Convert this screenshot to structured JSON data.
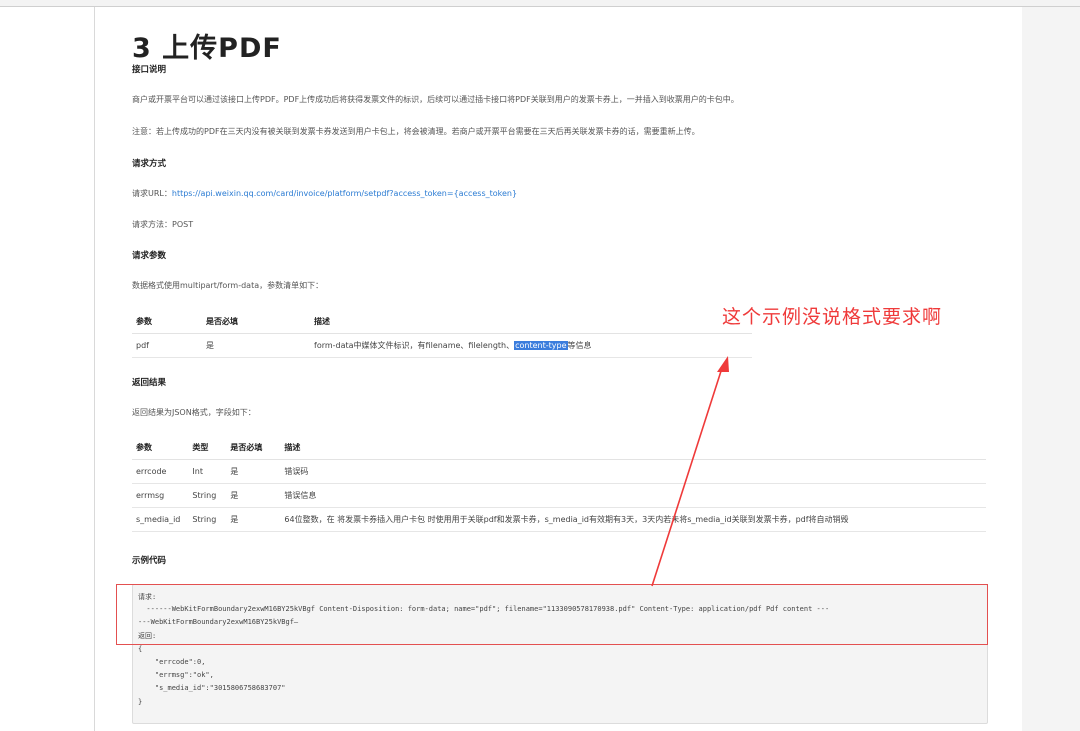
{
  "doc": {
    "title": "3 上传PDF",
    "section_intro": "接口说明",
    "intro_p1": "商户或开票平台可以通过该接口上传PDF。PDF上传成功后将获得发票文件的标识，后续可以通过插卡接口将PDF关联到用户的发票卡券上，一并插入到收票用户的卡包中。",
    "intro_p2": "注意：若上传成功的PDF在三天内没有被关联到发票卡券发送到用户卡包上，将会被清理。若商户或开票平台需要在三天后再关联发票卡券的话，需要重新上传。",
    "section_method": "请求方式",
    "url_label": "请求URL：",
    "url": "https://api.weixin.qq.com/card/invoice/platform/setpdf?access_token={access_token}",
    "method_line": "请求方法：POST",
    "section_params": "请求参数",
    "params_desc": "数据格式使用multipart/form-data，参数清单如下：",
    "params_table": {
      "headers": [
        "参数",
        "是否必填",
        "描述"
      ],
      "row": {
        "c1": "pdf",
        "c2": "是",
        "desc_pre": "form-data中媒体文件标识，有filename、filelength、",
        "desc_hl": "content-type",
        "desc_post": "等信息"
      }
    },
    "section_return": "返回结果",
    "return_desc": "返回结果为JSON格式，字段如下：",
    "return_table": {
      "headers": [
        "参数",
        "类型",
        "是否必填",
        "描述"
      ],
      "rows": [
        [
          "errcode",
          "Int",
          "是",
          "错误码"
        ],
        [
          "errmsg",
          "String",
          "是",
          "错误信息"
        ],
        [
          "s_media_id",
          "String",
          "是",
          "64位整数，在 将发票卡券插入用户卡包 时使用用于关联pdf和发票卡券，s_media_id有效期有3天，3天内若未将s_media_id关联到发票卡券，pdf将自动销毁"
        ]
      ]
    },
    "section_code": "示例代码",
    "code_lines": [
      "请求:",
      "  ------WebKitFormBoundary2exwM16BY25kVBgf Content-Disposition: form-data; name=\"pdf\"; filename=\"1133090578170938.pdf\" Content-Type: application/pdf Pdf content ---",
      "---WebKitFormBoundary2exwM16BY25kVBgf—",
      "返回:",
      "{",
      "    \"errcode\":0,",
      "    \"errmsg\":\"ok\",",
      "    \"s_media_id\":\"3015806758683707\"",
      "}"
    ]
  },
  "annotation": {
    "text": "这个示例没说格式要求啊",
    "color": "#ef3a3a"
  }
}
